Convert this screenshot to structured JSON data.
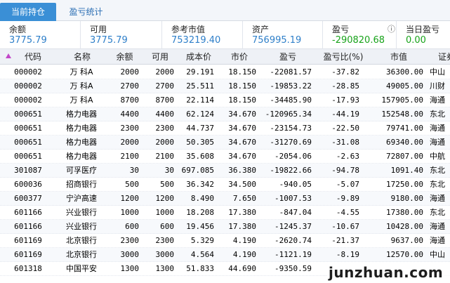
{
  "tabs": [
    {
      "label": "当前持仓",
      "active": true
    },
    {
      "label": "盈亏统计",
      "active": false
    }
  ],
  "summary": [
    {
      "label": "余额",
      "value": "3775.79",
      "color": "#2e7fc9"
    },
    {
      "label": "可用",
      "value": "3775.79",
      "color": "#2e7fc9"
    },
    {
      "label": "参考市值",
      "value": "753219.40",
      "color": "#2e7fc9"
    },
    {
      "label": "资产",
      "value": "756995.19",
      "color": "#2e7fc9"
    },
    {
      "label": "盈亏",
      "value": "-290820.68",
      "color": "#18a31a",
      "info_icon": "ⓘ"
    },
    {
      "label": "当日盈亏",
      "value": "0.00",
      "color": "#18a31a"
    }
  ],
  "table": {
    "columns": [
      "代码",
      "名称",
      "余额",
      "可用",
      "成本价",
      "市价",
      "盈亏",
      "盈亏比(%)",
      "市值",
      "证券"
    ],
    "rows": [
      [
        "000002",
        "万  科A",
        "2000",
        "2000",
        "29.191",
        "18.150",
        "-22081.57",
        "-37.82",
        "36300.00",
        "中山"
      ],
      [
        "000002",
        "万  科A",
        "2700",
        "2700",
        "25.511",
        "18.150",
        "-19853.22",
        "-28.85",
        "49005.00",
        "川财"
      ],
      [
        "000002",
        "万  科A",
        "8700",
        "8700",
        "22.114",
        "18.150",
        "-34485.90",
        "-17.93",
        "157905.00",
        "海通"
      ],
      [
        "000651",
        "格力电器",
        "4400",
        "4400",
        "62.124",
        "34.670",
        "-120965.34",
        "-44.19",
        "152548.00",
        "东北"
      ],
      [
        "000651",
        "格力电器",
        "2300",
        "2300",
        "44.737",
        "34.670",
        "-23154.73",
        "-22.50",
        "79741.00",
        "海通"
      ],
      [
        "000651",
        "格力电器",
        "2000",
        "2000",
        "50.305",
        "34.670",
        "-31270.69",
        "-31.08",
        "69340.00",
        "海通"
      ],
      [
        "000651",
        "格力电器",
        "2100",
        "2100",
        "35.608",
        "34.670",
        "-2054.06",
        "-2.63",
        "72807.00",
        "中航"
      ],
      [
        "301087",
        "可孚医疗",
        "30",
        "30",
        "697.085",
        "36.380",
        "-19822.66",
        "-94.78",
        "1091.40",
        "东北"
      ],
      [
        "600036",
        "招商银行",
        "500",
        "500",
        "36.342",
        "34.500",
        "-940.05",
        "-5.07",
        "17250.00",
        "东北"
      ],
      [
        "600377",
        "宁沪高速",
        "1200",
        "1200",
        "8.490",
        "7.650",
        "-1007.53",
        "-9.89",
        "9180.00",
        "海通"
      ],
      [
        "601166",
        "兴业银行",
        "1000",
        "1000",
        "18.208",
        "17.380",
        "-847.04",
        "-4.55",
        "17380.00",
        "东北"
      ],
      [
        "601166",
        "兴业银行",
        "600",
        "600",
        "19.456",
        "17.380",
        "-1245.37",
        "-10.67",
        "10428.00",
        "海通"
      ],
      [
        "601169",
        "北京银行",
        "2300",
        "2300",
        "5.329",
        "4.190",
        "-2620.74",
        "-21.37",
        "9637.00",
        "海通"
      ],
      [
        "601169",
        "北京银行",
        "3000",
        "3000",
        "4.564",
        "4.190",
        "-1121.19",
        "-8.19",
        "12570.00",
        "中山"
      ],
      [
        "601318",
        "中国平安",
        "1300",
        "1300",
        "51.833",
        "44.690",
        "-9350.59",
        "",
        "",
        ""
      ]
    ]
  },
  "watermark": "junzhuan.com"
}
